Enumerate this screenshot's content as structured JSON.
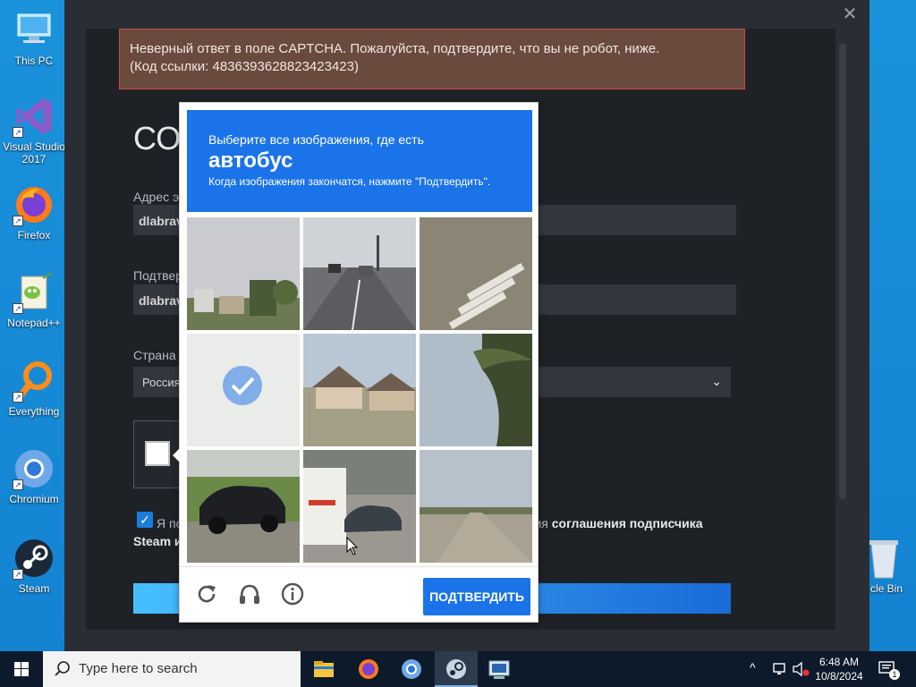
{
  "desktop": {
    "icons": [
      {
        "label": "This PC",
        "icon": "computer-icon"
      },
      {
        "label": "Visual Studio 2017",
        "icon": "visual-studio-icon"
      },
      {
        "label": "Firefox",
        "icon": "firefox-icon"
      },
      {
        "label": "Notepad++",
        "icon": "notepad-plus-plus-icon"
      },
      {
        "label": "Everything",
        "icon": "everything-search-icon"
      },
      {
        "label": "Chromium",
        "icon": "chromium-icon"
      },
      {
        "label": "Steam",
        "icon": "steam-icon"
      }
    ],
    "recycle_bin_label": "cle Bin"
  },
  "window": {
    "close_glyph": "✕",
    "error_line1": "Неверный ответ в поле CAPTCHA. Пожалуйста, подтвердите, что вы не робот, ниже.",
    "error_line2": "(Код ссылки: 4836393628823423423)",
    "title_partial": "СО",
    "email_label_partial": "Адрес э",
    "email_value_partial": "dlabrav",
    "confirm_label_partial": "Подтвер",
    "confirm_value_partial": "dlabrav",
    "country_label_partial": "Страна",
    "country_value_partial": "Россия",
    "agree_text_partial": "Я по",
    "agree_text_line2_partial": "Steam и",
    "agree_tail_prefix": "вия ",
    "agree_tail_link": "соглашения подписчика",
    "agree_checked": true
  },
  "captcha": {
    "instruction_line1": "Выберите все изображения, где есть",
    "target_word": "автобус",
    "instruction_line3": "Когда изображения закончатся, нажмите \"Подтвердить\".",
    "tiles": [
      {
        "scene": "houses-cloudy-sky",
        "selected": false
      },
      {
        "scene": "road-with-cars",
        "selected": false
      },
      {
        "scene": "crosswalk-asphalt",
        "selected": false
      },
      {
        "scene": "faded-selected",
        "selected": true
      },
      {
        "scene": "suburban-houses",
        "selected": false
      },
      {
        "scene": "palm-tree",
        "selected": false
      },
      {
        "scene": "black-car-street",
        "selected": false
      },
      {
        "scene": "ambulance-and-car",
        "selected": false
      },
      {
        "scene": "road-horizon",
        "selected": false
      }
    ],
    "verify_label": "ПОДТВЕРДИТЬ",
    "footer_icons": [
      "reload-icon",
      "audio-headphones-icon",
      "info-icon"
    ]
  },
  "taskbar": {
    "search_placeholder": "Type here to search",
    "apps": [
      "file-explorer-icon",
      "firefox-icon",
      "chromium-icon",
      "steam-icon",
      "network-app-icon"
    ],
    "time": "6:48 AM",
    "date": "10/8/2024",
    "notification_count": "1"
  }
}
